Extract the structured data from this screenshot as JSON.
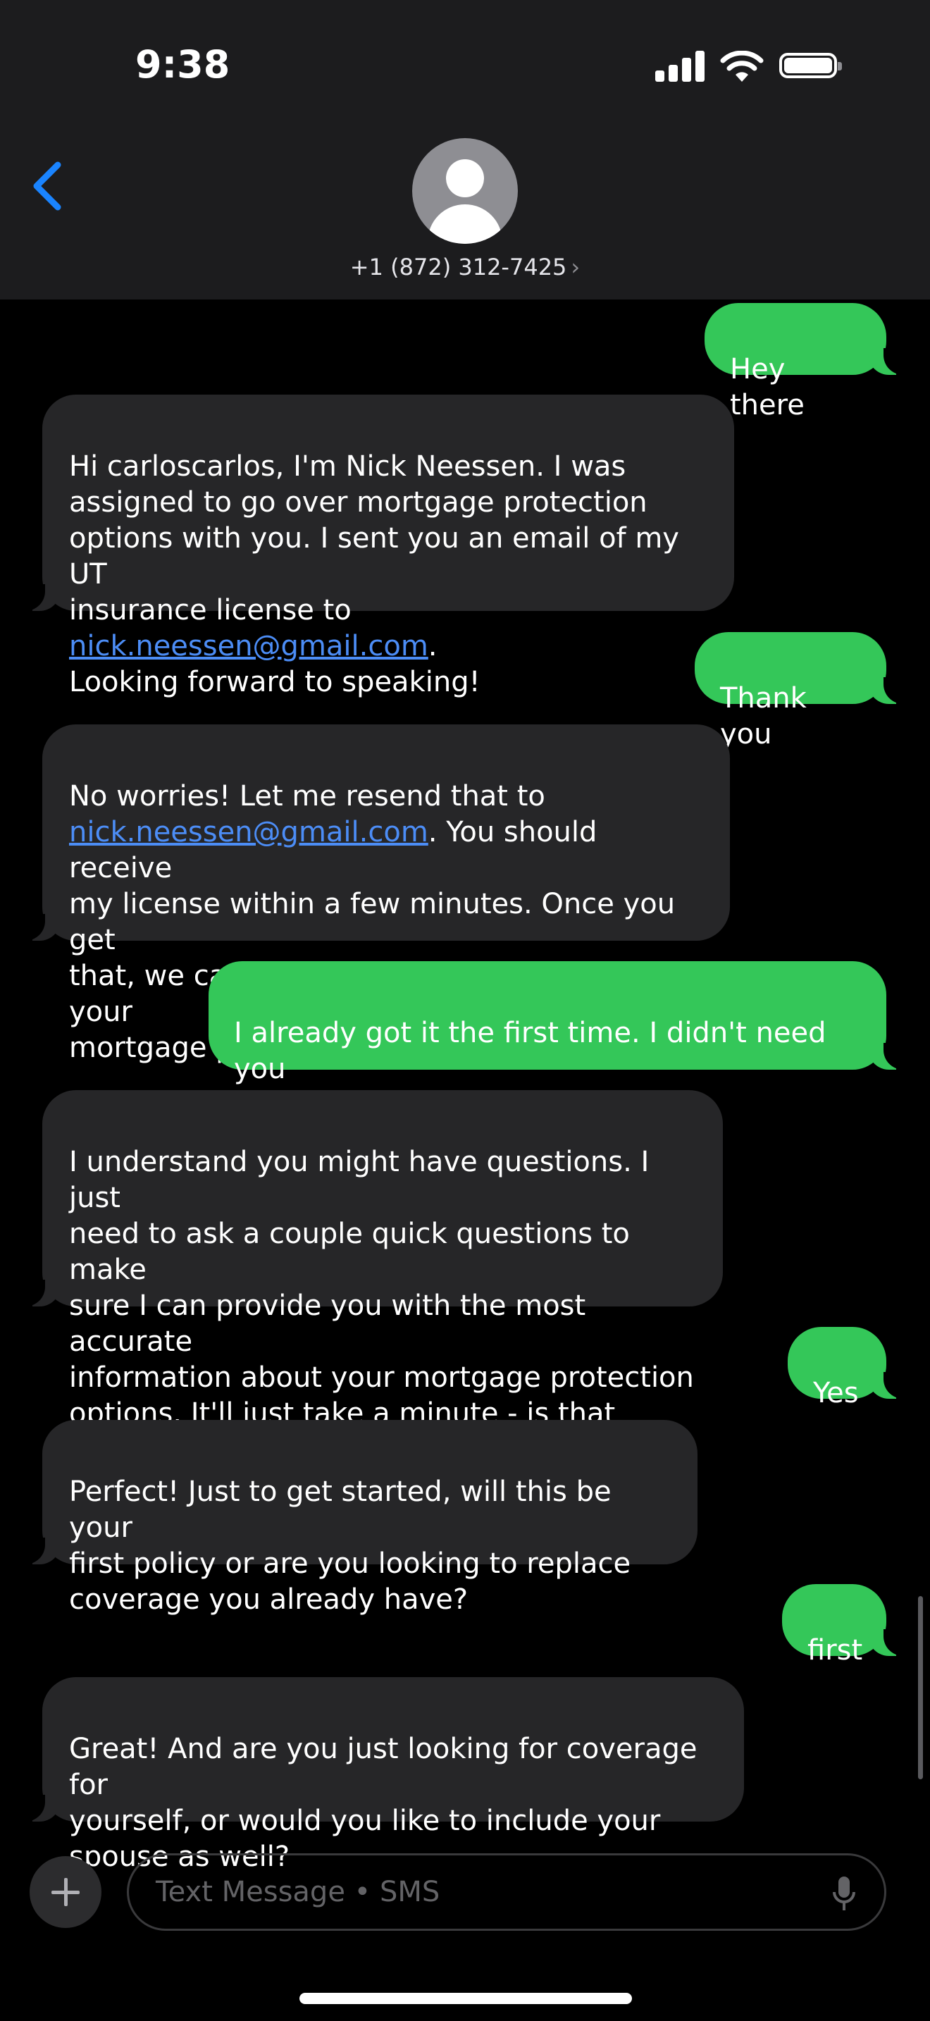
{
  "status_bar": {
    "time": "9:38"
  },
  "header": {
    "contact_phone": "+1 (872) 312-7425",
    "chevron": "›",
    "back_icon": "chevron-left-icon",
    "avatar_icon": "person-placeholder-icon"
  },
  "colors": {
    "outgoing": "#34c759",
    "incoming": "#262628",
    "link": "#4c8df6",
    "accent": "#1a84ff"
  },
  "messages": [
    {
      "from": "me",
      "text": "Hey there"
    },
    {
      "from": "them",
      "text_before": "Hi carloscarlos, I'm Nick Neessen. I was\nassigned to go over mortgage protection\noptions with you. I sent you an email of my UT\ninsurance license to ",
      "link": "nick.neessen@gmail.com",
      "text_after": ".\nLooking forward to speaking!"
    },
    {
      "from": "me",
      "text": "Thank you"
    },
    {
      "from": "them",
      "text_before": "No worries! Let me resend that to\n",
      "link": "nick.neessen@gmail.com",
      "text_after": ". You should receive\nmy license within a few minutes. Once you get\nthat, we can set up a quick call to review your\nmortgage protection options."
    },
    {
      "from": "me",
      "text": "I already got it the first time. I didn't need you\nto resend it to me."
    },
    {
      "from": "them",
      "text": "I understand you might have questions. I just\nneed to ask a couple quick questions to make\nsure I can provide you with the most accurate\ninformation about your mortgage protection\noptions. It'll just take a minute - is that okay?"
    },
    {
      "from": "me",
      "text": "Yes"
    },
    {
      "from": "them",
      "text": "Perfect! Just to get started, will this be your\nfirst policy or are you looking to replace\ncoverage you already have?"
    },
    {
      "from": "me",
      "text": "first"
    },
    {
      "from": "them",
      "text": "Great! And are you just looking for coverage for\nyourself, or would you like to include your\nspouse as well?"
    }
  ],
  "composer": {
    "placeholder": "Text Message • SMS",
    "plus_icon": "plus-icon",
    "mic_icon": "microphone-icon"
  }
}
